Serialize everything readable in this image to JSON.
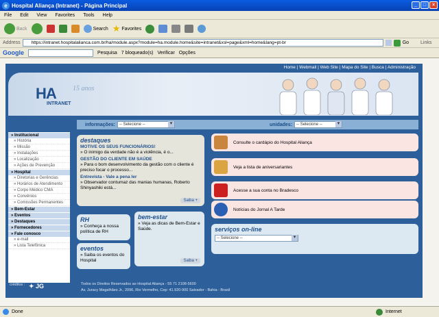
{
  "window": {
    "title": "Hospital Aliança (Intranet) - Página Principal"
  },
  "menu": [
    "File",
    "Edit",
    "View",
    "Favorites",
    "Tools",
    "Help"
  ],
  "toolbar": {
    "back": "Back",
    "search": "Search",
    "favorites": "Favorites"
  },
  "address": {
    "label": "Address",
    "url": "https://intranet.hospitalalianca.com.br/ha/module.aspx?module=ha.module.home&site=intranet&xsl=page&xml=home&lang=pt-br",
    "go": "Go",
    "links": "Links"
  },
  "googlebar": {
    "logo": "Google",
    "pesquisa": "Pesquisa",
    "bloqueados": "7 bloqueado(s)",
    "verificar": "Verificar",
    "opcoes": "Opções"
  },
  "site": {
    "topnav": "Home | Webmail | Web Site | Mapa do Site | Busca | Administração",
    "logo": "HA",
    "logo_sub": "INTRANET",
    "anos": "15 anos",
    "informacoes_label": "informações:",
    "informacoes_value": "-- Selecione --",
    "unidades_label": "unidades:",
    "unidades_value": "-- Selecione --",
    "sidebar": [
      {
        "label": "» Institucional",
        "type": "sec"
      },
      {
        "label": "» História",
        "type": "sub"
      },
      {
        "label": "» Missão",
        "type": "sub"
      },
      {
        "label": "» Instalações",
        "type": "sub"
      },
      {
        "label": "» Localização",
        "type": "sub"
      },
      {
        "label": "» Ações de Prevenção",
        "type": "sub"
      },
      {
        "label": "» Hospital",
        "type": "sec"
      },
      {
        "label": "» Diretorias e Gerências",
        "type": "sub"
      },
      {
        "label": "» Horários de Atendimento",
        "type": "sub"
      },
      {
        "label": "» Corpo Médico CMA",
        "type": "sub"
      },
      {
        "label": "» Convênios",
        "type": "sub"
      },
      {
        "label": "» Comissões Permanentes",
        "type": "sub"
      },
      {
        "label": "» Bem-Estar",
        "type": "sec"
      },
      {
        "label": "» Eventos",
        "type": "sec"
      },
      {
        "label": "» Destaques",
        "type": "sec"
      },
      {
        "label": "» Fornecedores",
        "type": "sec"
      },
      {
        "label": "» Fale conosco",
        "type": "sec"
      },
      {
        "label": "» e-mail",
        "type": "sub"
      },
      {
        "label": "» Lista Telefônica",
        "type": "sub"
      }
    ],
    "destaques": {
      "title": "destaques",
      "h1": "MOTIVE OS SEUS FUNCIONÁRIOS!",
      "t1": "» O inimigo da verdade não é a violência, é o...",
      "h2": "GESTÃO DO CLIENTE EM SAÚDE",
      "t2": "» Para o bom desenvolvimento da gestão com o cliente é preciso focar o processo...",
      "h3": "Entrevista - Vale a pena ler",
      "t3": "» Observador contumaz das manias humanas, Roberto Shinyashiki está...",
      "saiba": "Saiba +"
    },
    "rh": {
      "title": "RH",
      "text": "» Conheça a nossa política de RH"
    },
    "eventos": {
      "title": "eventos",
      "text": "» Saiba os eventos do Hospital"
    },
    "bemestar": {
      "title": "bem-estar",
      "text": "» Veja as dicas de Bem-Estar e Saúde.",
      "saiba": "Saiba +"
    },
    "right_cards": [
      "Consulte o cardápio do Hospital Aliança",
      "Veja a lista de aniversariantes",
      "Acesse a sua conta no Bradesco",
      "Notícias do Jornal A Tarde"
    ],
    "servicos": {
      "title": "serviços on-line",
      "value": "-- Selecione --"
    },
    "creditos": "créditos :",
    "footer1": "Todos os Direitos Reservados ao Hospital Aliança - 55 71 2108-5600",
    "footer2": "Av. Juracy Magalhães Jr., 2096, Rio Vermelho, Cep: 41.920-900 Salvador - Bahia - Brasil"
  },
  "status": {
    "left": "Done",
    "right": "Internet"
  },
  "colors": {
    "page_bg": "#2d5f9a",
    "accent": "#1f4f8c"
  }
}
